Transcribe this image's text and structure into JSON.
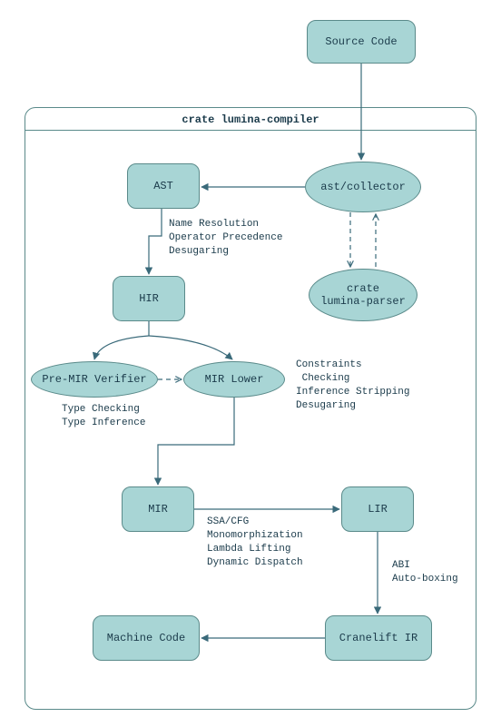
{
  "nodes": {
    "source_code": "Source Code",
    "crate_title": "crate lumina-compiler",
    "ast": "AST",
    "collector": "ast/collector",
    "parser": "crate\nlumina-parser",
    "hir": "HIR",
    "premir": "Pre-MIR Verifier",
    "mirlower": "MIR Lower",
    "mir": "MIR",
    "lir": "LIR",
    "cranelift": "Cranelift IR",
    "machine": "Machine Code"
  },
  "labels": {
    "ast_to_hir": "Name Resolution\nOperator Precedence\nDesugaring",
    "premir_below": "Type Checking\nType Inference",
    "mirlower_side": "Constraints\n Checking\nInference Stripping\nDesugaring",
    "mir_to_lir": "SSA/CFG\nMonomorphization\nLambda Lifting\nDynamic Dispatch",
    "lir_to_cranelift": "ABI\nAuto-boxing"
  },
  "chart_data": {
    "type": "table",
    "title": "crate lumina-compiler pipeline",
    "nodes": [
      {
        "id": "source_code",
        "label": "Source Code",
        "shape": "rect"
      },
      {
        "id": "collector",
        "label": "ast/collector",
        "shape": "ellipse"
      },
      {
        "id": "parser",
        "label": "crate lumina-parser",
        "shape": "ellipse"
      },
      {
        "id": "ast",
        "label": "AST",
        "shape": "rect"
      },
      {
        "id": "hir",
        "label": "HIR",
        "shape": "rect"
      },
      {
        "id": "premir",
        "label": "Pre-MIR Verifier",
        "shape": "ellipse"
      },
      {
        "id": "mirlower",
        "label": "MIR Lower",
        "shape": "ellipse"
      },
      {
        "id": "mir",
        "label": "MIR",
        "shape": "rect"
      },
      {
        "id": "lir",
        "label": "LIR",
        "shape": "rect"
      },
      {
        "id": "cranelift",
        "label": "Cranelift IR",
        "shape": "rect"
      },
      {
        "id": "machine",
        "label": "Machine Code",
        "shape": "rect"
      }
    ],
    "edges": [
      {
        "from": "source_code",
        "to": "collector",
        "style": "solid"
      },
      {
        "from": "collector",
        "to": "ast",
        "style": "solid"
      },
      {
        "from": "collector",
        "to": "parser",
        "style": "dashed-bidir"
      },
      {
        "from": "ast",
        "to": "hir",
        "style": "solid",
        "label": "Name Resolution / Operator Precedence / Desugaring"
      },
      {
        "from": "hir",
        "to": "premir",
        "style": "solid"
      },
      {
        "from": "hir",
        "to": "mirlower",
        "style": "solid"
      },
      {
        "from": "premir",
        "to": "mirlower",
        "style": "dashed",
        "label": "Type Checking / Type Inference"
      },
      {
        "from": "mirlower",
        "to": "mir",
        "style": "solid",
        "label": "Constraints Checking / Inference Stripping / Desugaring"
      },
      {
        "from": "mir",
        "to": "lir",
        "style": "solid",
        "label": "SSA/CFG / Monomorphization / Lambda Lifting / Dynamic Dispatch"
      },
      {
        "from": "lir",
        "to": "cranelift",
        "style": "solid",
        "label": "ABI / Auto-boxing"
      },
      {
        "from": "cranelift",
        "to": "machine",
        "style": "solid"
      }
    ]
  }
}
